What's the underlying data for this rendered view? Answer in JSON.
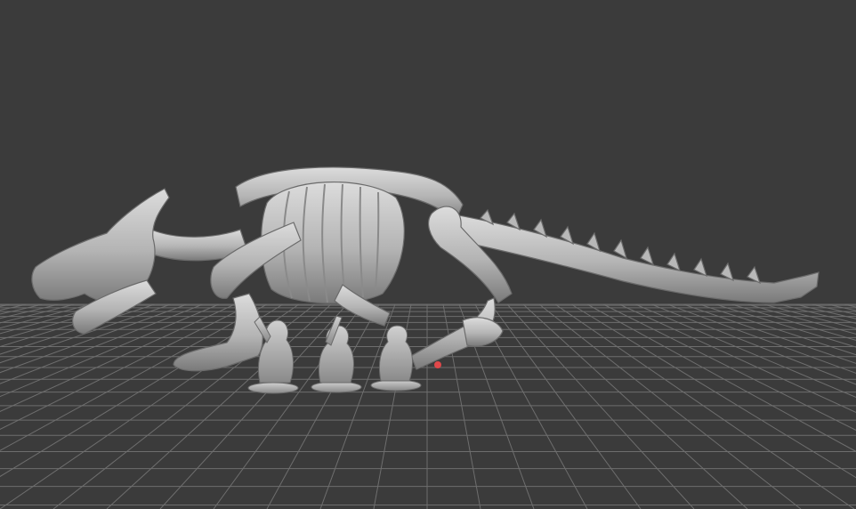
{
  "viewport": {
    "background": "#3b3b3b",
    "grid_color": "#6e6e6e",
    "model_color": "#c4c4c4",
    "model_shadow": "#7d7d7d",
    "marker_color": "#e0484a"
  },
  "scene": {
    "objects": [
      {
        "name": "dragon-skeleton-model"
      },
      {
        "name": "miniature-figure-1"
      },
      {
        "name": "miniature-figure-2"
      },
      {
        "name": "miniature-figure-3"
      }
    ]
  }
}
